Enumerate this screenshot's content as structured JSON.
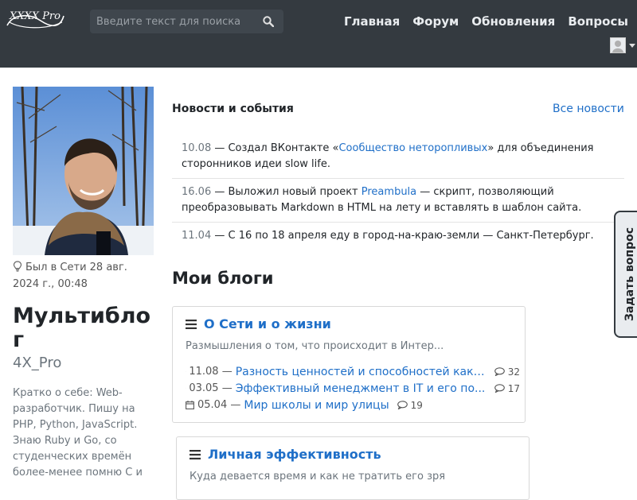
{
  "navbar": {
    "logo_text": "XXXX Pro",
    "search_placeholder": "Введите текст для поиска",
    "links": [
      "Главная",
      "Форум",
      "Обновления",
      "Вопросы"
    ]
  },
  "profile": {
    "last_seen": "Был в Сети 28 авг. 2024 г., 00:48",
    "name": "Мультиблог",
    "handle": "4X_Pro",
    "about": "Кратко о себе: Web-разработчик. Пишу на PHP, Python, JavaScript. Знаю Ruby и Go, со студенческих времён более-менее помню С и"
  },
  "news": {
    "title": "Новости и события",
    "all_link": "Все новости",
    "items": [
      {
        "date": "10.08",
        "before": "Создал ВКонтакте «",
        "link": "Сообщество неторопливых",
        "after": "» для объединения сторонников идеи slow life."
      },
      {
        "date": "16.06",
        "before": "Выложил новый проект ",
        "link": "Preambula",
        "after": " — скрипт, позволяющий преобразовывать Markdown в HTML на лету и вставлять в шаблон сайта."
      },
      {
        "date": "11.04",
        "before": "С 16 по 18 апреля еду в город-на-краю-земли — Санкт-Петербург.",
        "link": "",
        "after": ""
      }
    ]
  },
  "ask_tab": "Задать вопрос",
  "blogs": {
    "title": "Мои блоги",
    "cards": [
      {
        "name": "О Сети и о жизни",
        "description": "Размышления о том, что происходит в Интер...",
        "posts": [
          {
            "date": "11.08",
            "title": "Разность ценностей и способностей как ...",
            "comments": "32"
          },
          {
            "date": "03.05",
            "title": "Эффективный менеджмент в IT и его по...",
            "comments": "17"
          },
          {
            "date": "05.04",
            "title": "Мир школы и мир улицы",
            "comments": "19"
          }
        ]
      },
      {
        "name": "Личная эффективность",
        "description": "Куда девается время и как не тратить его зря",
        "posts": []
      }
    ]
  },
  "colors": {
    "navbar_bg": "#343a40",
    "link": "#1f6fc8",
    "muted": "#6c757d"
  }
}
